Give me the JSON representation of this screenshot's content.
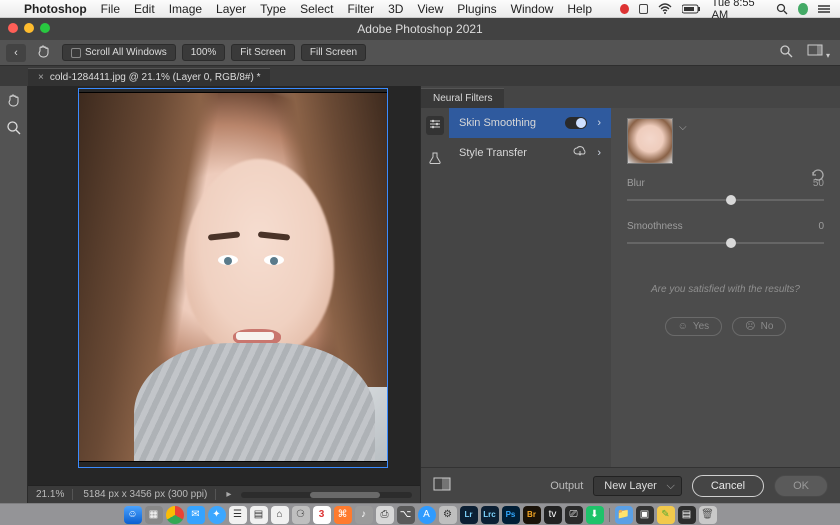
{
  "menubar": {
    "app": "Photoshop",
    "items": [
      "File",
      "Edit",
      "Image",
      "Layer",
      "Type",
      "Select",
      "Filter",
      "3D",
      "View",
      "Plugins",
      "Window",
      "Help"
    ],
    "clock": "Tue 8:55 AM"
  },
  "window": {
    "title": "Adobe Photoshop 2021"
  },
  "options_bar": {
    "scroll_all": "Scroll All Windows",
    "zoom_pct": "100%",
    "fit_screen": "Fit Screen",
    "fill_screen": "Fill Screen"
  },
  "document": {
    "tab_label": "cold-1284411.jpg @ 21.1% (Layer 0, RGB/8#) *",
    "status_zoom": "21.1%",
    "status_dims": "5184 px x 3456 px (300 ppi)"
  },
  "neural_panel": {
    "tab": "Neural Filters",
    "filters": [
      {
        "label": "Skin Smoothing",
        "state": "on"
      },
      {
        "label": "Style Transfer",
        "state": "cloud"
      }
    ],
    "sliders": {
      "blur": {
        "label": "Blur",
        "value": 50,
        "min": 0,
        "max": 100
      },
      "smoothness": {
        "label": "Smoothness",
        "value": 0,
        "min": -50,
        "max": 50
      }
    },
    "satisfied": "Are you satisfied with the results?",
    "yes": "Yes",
    "no": "No",
    "output_label": "Output",
    "output_value": "New Layer",
    "cancel": "Cancel",
    "ok": "OK"
  }
}
